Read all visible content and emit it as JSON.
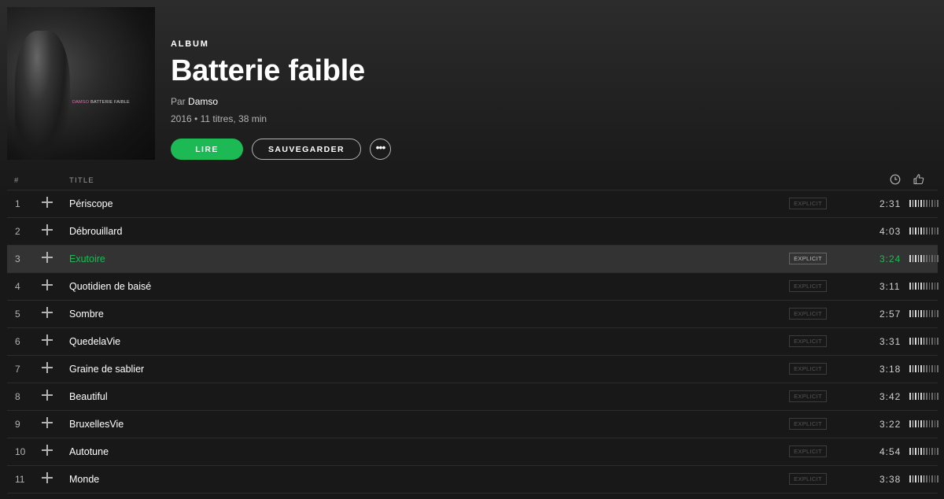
{
  "album": {
    "cover_text_artist": "DAMSO",
    "cover_text_title": "BATTERIE FAIBLE",
    "type_label": "ALBUM",
    "title": "Batterie faible",
    "by_prefix": "Par",
    "artist": "Damso",
    "meta": "2016 • 11 titres, 38 min"
  },
  "actions": {
    "play_label": "LIRE",
    "save_label": "SAUVEGARDER",
    "more_label": "•••"
  },
  "table_header": {
    "num": "#",
    "title": "TITLE",
    "duration_icon": "clock-icon",
    "popularity_icon": "thumbs-up-icon"
  },
  "colors": {
    "accent": "#1db954",
    "background": "#181818",
    "active_row": "#333333"
  },
  "tracks": [
    {
      "num": "1",
      "title": "Périscope",
      "explicit": "EXPLICIT",
      "duration": "2:31",
      "popularity": 0.5
    },
    {
      "num": "2",
      "title": "Débrouillard",
      "explicit": "",
      "duration": "4:03",
      "popularity": 0.5
    },
    {
      "num": "3",
      "title": "Exutoire",
      "explicit": "EXPLICIT",
      "duration": "3:24",
      "popularity": 0.5,
      "active": true
    },
    {
      "num": "4",
      "title": "Quotidien de baisé",
      "explicit": "EXPLICIT",
      "duration": "3:11",
      "popularity": 0.5
    },
    {
      "num": "5",
      "title": "Sombre",
      "explicit": "EXPLICIT",
      "duration": "2:57",
      "popularity": 0.5
    },
    {
      "num": "6",
      "title": "QuedelaVie",
      "explicit": "EXPLICIT",
      "duration": "3:31",
      "popularity": 0.5
    },
    {
      "num": "7",
      "title": "Graine de sablier",
      "explicit": "EXPLICIT",
      "duration": "3:18",
      "popularity": 0.5
    },
    {
      "num": "8",
      "title": "Beautiful",
      "explicit": "EXPLICIT",
      "duration": "3:42",
      "popularity": 0.5
    },
    {
      "num": "9",
      "title": "BruxellesVie",
      "explicit": "EXPLICIT",
      "duration": "3:22",
      "popularity": 0.5
    },
    {
      "num": "10",
      "title": "Autotune",
      "explicit": "EXPLICIT",
      "duration": "4:54",
      "popularity": 0.5
    },
    {
      "num": "11",
      "title": "Monde",
      "explicit": "EXPLICIT",
      "duration": "3:38",
      "popularity": 0.5
    }
  ]
}
